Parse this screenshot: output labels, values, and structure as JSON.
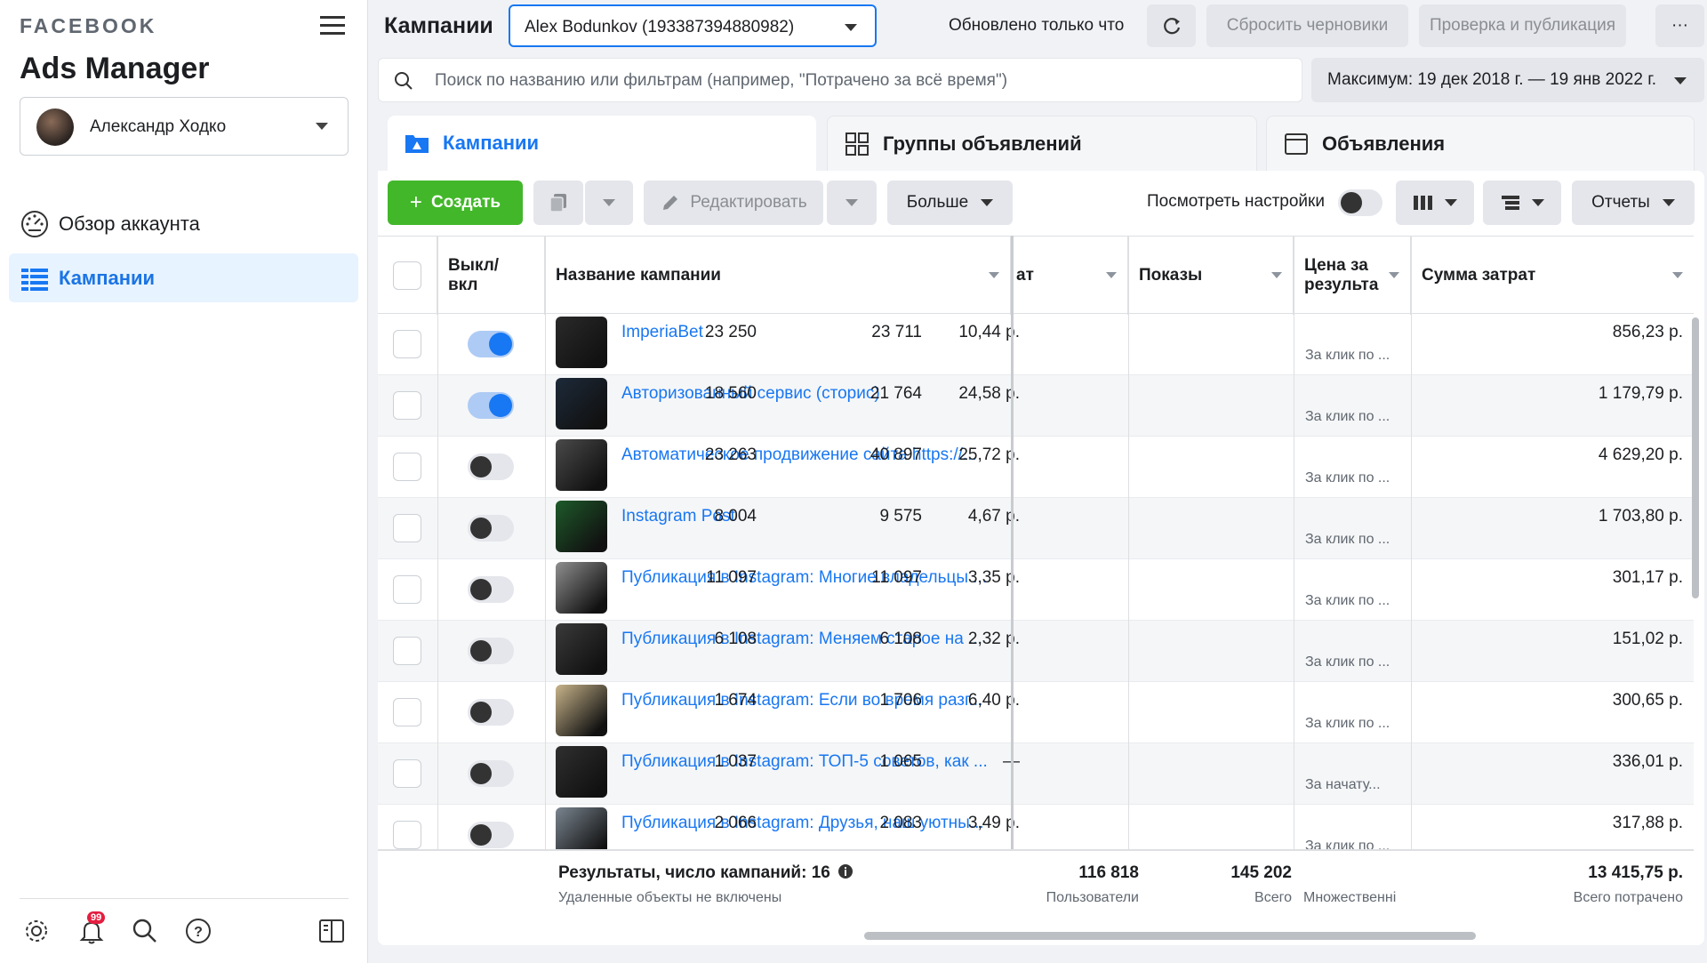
{
  "brand": {
    "wordmark": "FACEBOOK",
    "app_title": "Ads Manager"
  },
  "account_user": {
    "name": "Александр Ходко"
  },
  "sidebar": {
    "items": [
      {
        "label": "Обзор аккаунта",
        "icon": "dashboard-icon",
        "active": false
      },
      {
        "label": "Кампании",
        "icon": "table-grid-icon",
        "active": true
      }
    ],
    "bottom_icons": [
      "gear-icon",
      "bell-icon",
      "search-icon",
      "help-icon",
      "panel-toggle-icon"
    ],
    "notification_count": "99"
  },
  "header": {
    "title": "Кампании",
    "ad_account": "Alex Bodunkov (193387394880982)",
    "updated_text": "Обновлено только что",
    "reset_label": "Сбросить черновики",
    "publish_label": "Проверка и публикация",
    "more_label": "···"
  },
  "search": {
    "placeholder": "Поиск по названию или фильтрам (например, \"Потрачено за всё время\")",
    "date_range": "Максимум: 19 дек 2018 г. — 19 янв 2022 г."
  },
  "tabs": [
    {
      "label": "Кампании",
      "icon": "folder-icon",
      "active": true
    },
    {
      "label": "Группы объявлений",
      "icon": "grid-icon",
      "active": false
    },
    {
      "label": "Объявления",
      "icon": "ad-icon",
      "active": false
    }
  ],
  "toolbar": {
    "create_label": "Создать",
    "edit_label": "Редактировать",
    "more_label": "Больше",
    "view_settings_label": "Посмотреть настройки",
    "reports_label": "Отчеты"
  },
  "table": {
    "columns": {
      "toggle": "Выкл/\nвкл",
      "name": "Название кампании",
      "results_partial": "ат",
      "impressions": "Показы",
      "cpr": "Цена за результа",
      "spend": "Сумма затрат"
    },
    "rows": [
      {
        "on": true,
        "name": "ImperiaBet",
        "results": "23 250",
        "impressions": "23 711",
        "cpr": "10,44 р.",
        "cpr_sub": "За клик по ...",
        "spend": "856,23 р.",
        "thumb": "#2a2a2a"
      },
      {
        "on": true,
        "name": "Авторизованный сервис (сторис)",
        "results": "18 560",
        "impressions": "21 764",
        "cpr": "24,58 р.",
        "cpr_sub": "За клик по ...",
        "spend": "1 179,79 р.",
        "thumb": "#1d2a3a"
      },
      {
        "on": false,
        "name": "Автоматическое продвижение сайта https://...",
        "results": "23 263",
        "impressions": "40 897",
        "cpr": "25,72 р.",
        "cpr_sub": "За клик по ...",
        "spend": "4 629,20 р.",
        "thumb": "#4a4a4a"
      },
      {
        "on": false,
        "name": "Instagram Post",
        "results": "8 004",
        "impressions": "9 575",
        "cpr": "4,67 р.",
        "cpr_sub": "За клик по ...",
        "spend": "1 703,80 р.",
        "thumb": "#1e5a2a"
      },
      {
        "on": false,
        "name": "Публикация в Instagram: Многие владельцы ...",
        "results": "11 097",
        "impressions": "11 097",
        "cpr": "3,35 р.",
        "cpr_sub": "За клик по ...",
        "spend": "301,17 р.",
        "thumb": "#8f8f8f"
      },
      {
        "on": false,
        "name": "Публикация в Instagram: Меняем старое на ...",
        "results": "6 108",
        "impressions": "6 108",
        "cpr": "2,32 р.",
        "cpr_sub": "За клик по ...",
        "spend": "151,02 р.",
        "thumb": "#3a3a3a"
      },
      {
        "on": false,
        "name": "Публикация в Instagram: Если во время разг...",
        "results": "1 674",
        "impressions": "1 706",
        "cpr": "6,40 р.",
        "cpr_sub": "За клик по ...",
        "spend": "300,65 р.",
        "thumb": "#c8b48a"
      },
      {
        "on": false,
        "name": "Публикация в Instagram: ТОП-5 советов, как ...",
        "results": "1 037",
        "impressions": "1 065",
        "cpr": "—",
        "cpr_sub": "За начату...",
        "spend": "336,01 р.",
        "thumb": "#2f2f2f"
      },
      {
        "on": false,
        "name": "Публикация в Instagram: Друзья, наш уютны...",
        "results": "2 066",
        "impressions": "2 083",
        "cpr": "3,49 р.",
        "cpr_sub": "За клик по ...",
        "spend": "317,88 р.",
        "thumb": "#7a8590"
      }
    ],
    "totals": {
      "label": "Результаты, число кампаний: 16",
      "sub": "Удаленные объекты не включены",
      "results": "116 818",
      "results_sub": "Пользователи",
      "impressions": "145 202",
      "impressions_sub": "Всего",
      "cpr_sub": "Множественні",
      "spend": "13 415,75 р.",
      "spend_sub": "Всего потрачено"
    }
  },
  "colors": {
    "accent": "#1877f2",
    "create": "#42b72a",
    "badge": "#e41e3f"
  }
}
